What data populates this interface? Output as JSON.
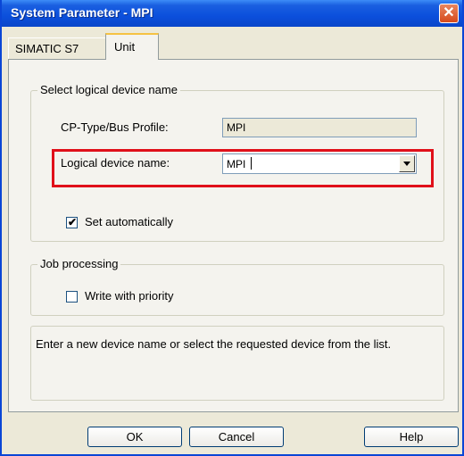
{
  "window": {
    "title": "System Parameter - MPI",
    "close_glyph": "✕"
  },
  "tabs": [
    {
      "label": "SIMATIC S7",
      "selected": false
    },
    {
      "label": "Unit",
      "selected": true
    }
  ],
  "logical_device_group": {
    "title": "Select logical device name",
    "cp_type_label": "CP-Type/Bus Profile:",
    "cp_type_value": "MPI",
    "logical_device_label": "Logical device name:",
    "logical_device_value": "MPI",
    "set_automatically_label": "Set automatically",
    "set_automatically_checked": true
  },
  "job_processing_group": {
    "title": "Job processing",
    "write_priority_label": "Write with priority",
    "write_priority_checked": false
  },
  "info_text": "Enter a new device name or select the requested device from the list.",
  "buttons": {
    "ok": "OK",
    "cancel": "Cancel",
    "help": "Help"
  },
  "colors": {
    "titlebar": "#0b4fdc",
    "highlight": "#e0101a",
    "dialog_bg": "#ece9d8"
  }
}
